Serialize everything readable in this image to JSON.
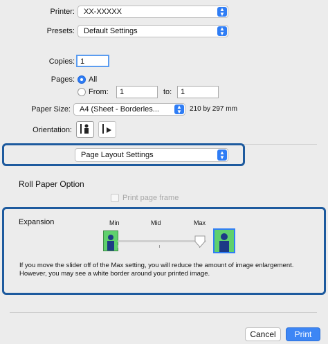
{
  "printer": {
    "label": "Printer:",
    "value": "XX-XXXXX"
  },
  "presets": {
    "label": "Presets:",
    "value": "Default Settings"
  },
  "copies": {
    "label": "Copies:",
    "value": "1"
  },
  "pages": {
    "label": "Pages:",
    "all_label": "All",
    "from_label": "From:",
    "from_value": "1",
    "to_label": "to:",
    "to_value": "1",
    "selected": "All"
  },
  "paper_size": {
    "label": "Paper Size:",
    "value": "A4 (Sheet - Borderles...",
    "dimensions": "210 by 297 mm"
  },
  "orientation": {
    "label": "Orientation:",
    "portrait_icon": "portrait-orientation-icon",
    "landscape_icon": "landscape-orientation-icon"
  },
  "panel_menu": {
    "value": "Page Layout Settings"
  },
  "roll_paper": {
    "heading": "Roll Paper Option",
    "print_frame_label": "Print page frame",
    "print_frame_checked": false
  },
  "expansion": {
    "label": "Expansion",
    "min_label": "Min",
    "mid_label": "Mid",
    "max_label": "Max",
    "level": "Max",
    "level_fraction": 1.0,
    "note": "If you move the slider off of the Max setting, you will reduce the amount of image enlargement. However, you may see a white border around your printed image."
  },
  "buttons": {
    "cancel": "Cancel",
    "print": "Print"
  },
  "colors": {
    "accent": "#2f7df5",
    "highlight_frame": "#1d5a9e"
  }
}
